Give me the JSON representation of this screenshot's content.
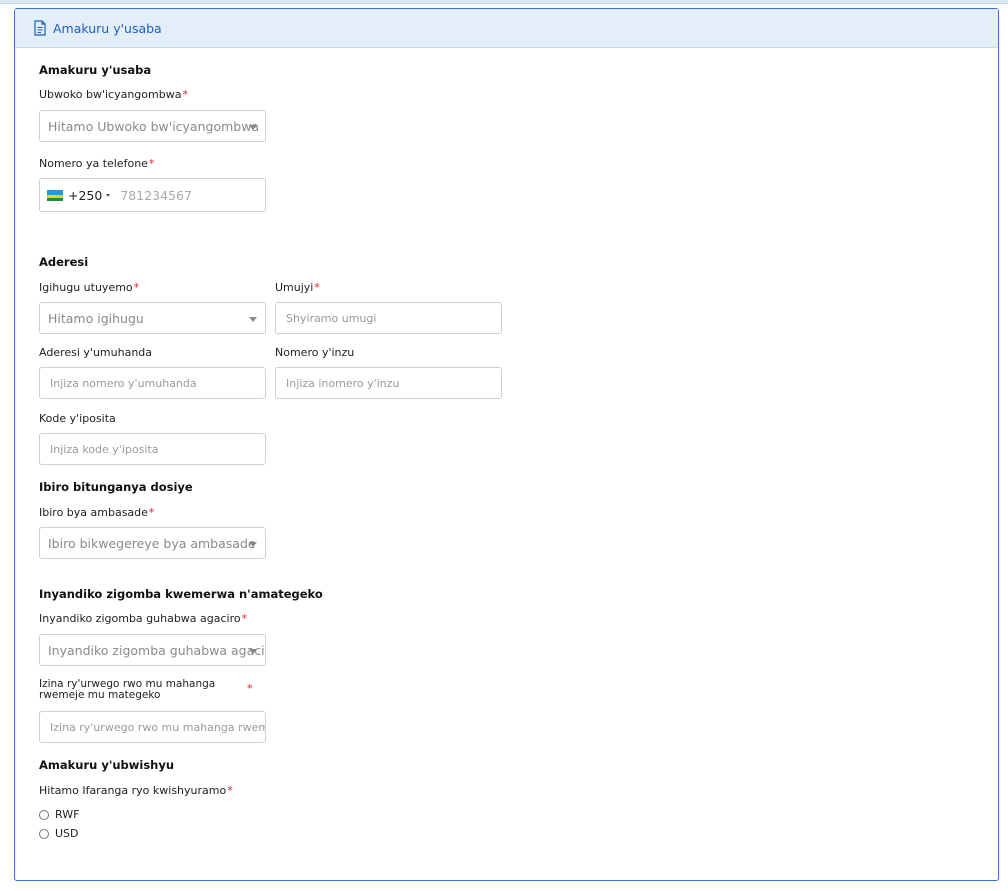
{
  "card": {
    "header_title": "Amakuru y'usaba",
    "header_icon": "document-icon"
  },
  "sections": {
    "applicant": {
      "title": "Amakuru y'usaba",
      "visa_type_label": "Ubwoko bw'icyangombwa",
      "visa_type_placeholder": "Hitamo Ubwoko bw'icyangombwa",
      "phone_label": "Nomero ya telefone",
      "phone_country_code": "+250",
      "phone_placeholder": "781234567"
    },
    "address": {
      "title": "Aderesi",
      "country_label": "Igihugu utuyemo",
      "country_placeholder": "Hitamo igihugu",
      "city_label": "Umujyi",
      "city_placeholder": "Shyiramo umugi",
      "street_label": "Aderesi y'umuhanda",
      "street_placeholder": "Injiza nomero y'umuhanda",
      "house_label": "Nomero y'inzu",
      "house_placeholder": "Injiza inomero y'inzu",
      "postal_label": "Kode y'iposita",
      "postal_placeholder": "Injiza kode y'iposita"
    },
    "office": {
      "title": "Ibiro bitunganya dosiye",
      "embassy_label": "Ibiro bya ambasade",
      "embassy_placeholder": "Ibiro bikwegereye bya ambasade"
    },
    "legalization": {
      "title": "Inyandiko zigomba kwemerwa n'amategeko",
      "docs_label": "Inyandiko zigomba guhabwa agaciro",
      "docs_placeholder": "Inyandiko zigomba guhabwa agaciro",
      "institution_label_line1": "Izina ry'urwego rwo mu mahanga",
      "institution_label_line2": "rwemeje mu mategeko",
      "institution_placeholder": "Izina ry'urwego rwo mu mahanga rwemeje mu mategeko"
    },
    "payment": {
      "title": "Amakuru y'ubwishyu",
      "currency_label": "Hitamo Ifaranga ryo kwishyuramo",
      "options": [
        "RWF",
        "USD"
      ]
    }
  },
  "required_mark": "*",
  "colors": {
    "accent": "#1f5fbf",
    "header_bg": "#e3eef9",
    "required": "#e0202a",
    "card_border": "#3a6fd6"
  }
}
